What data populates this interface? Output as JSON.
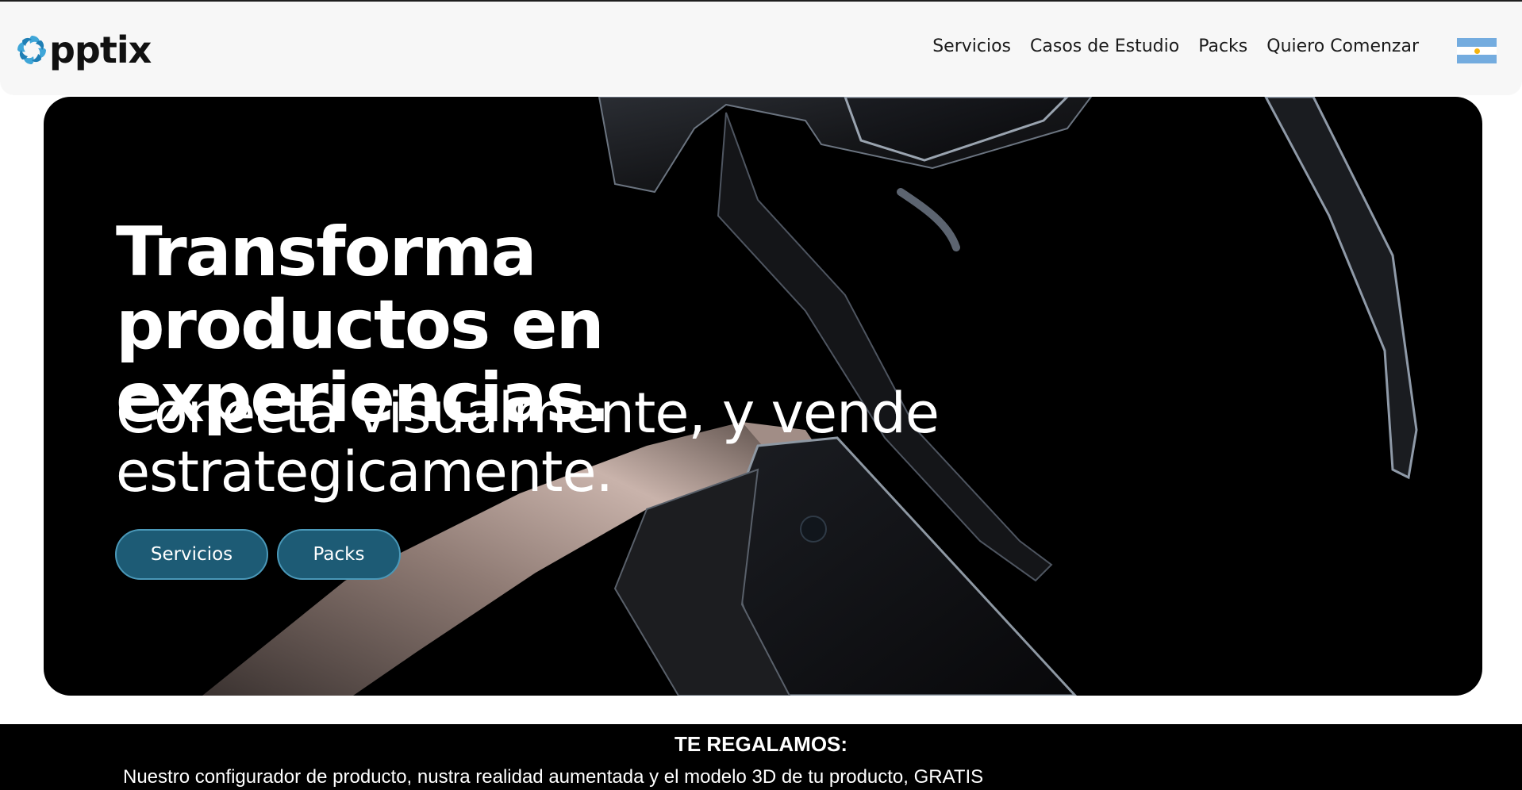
{
  "header": {
    "logo_text": "pptix",
    "nav": [
      {
        "label": "Servicios"
      },
      {
        "label": "Casos de Estudio"
      },
      {
        "label": "Packs"
      },
      {
        "label": "Quiero Comenzar"
      }
    ],
    "flag_icon": "argentina-flag-icon"
  },
  "hero": {
    "title": "Transforma productos en experiencias.",
    "subtitle": "Conecta visualmente, y vende estrategicamente.",
    "buttons": [
      {
        "label": "Servicios"
      },
      {
        "label": "Packs"
      }
    ],
    "button_color": "#1d5b75"
  },
  "banner": {
    "title": "TE REGALAMOS:",
    "text": "Nuestro configurador de producto, nustra realidad aumentada y el modelo 3D de tu producto, GRATIS"
  },
  "colors": {
    "accent": "#1d5b75",
    "logo_blue": "#3fa6d8",
    "hero_bg": "#000000"
  }
}
